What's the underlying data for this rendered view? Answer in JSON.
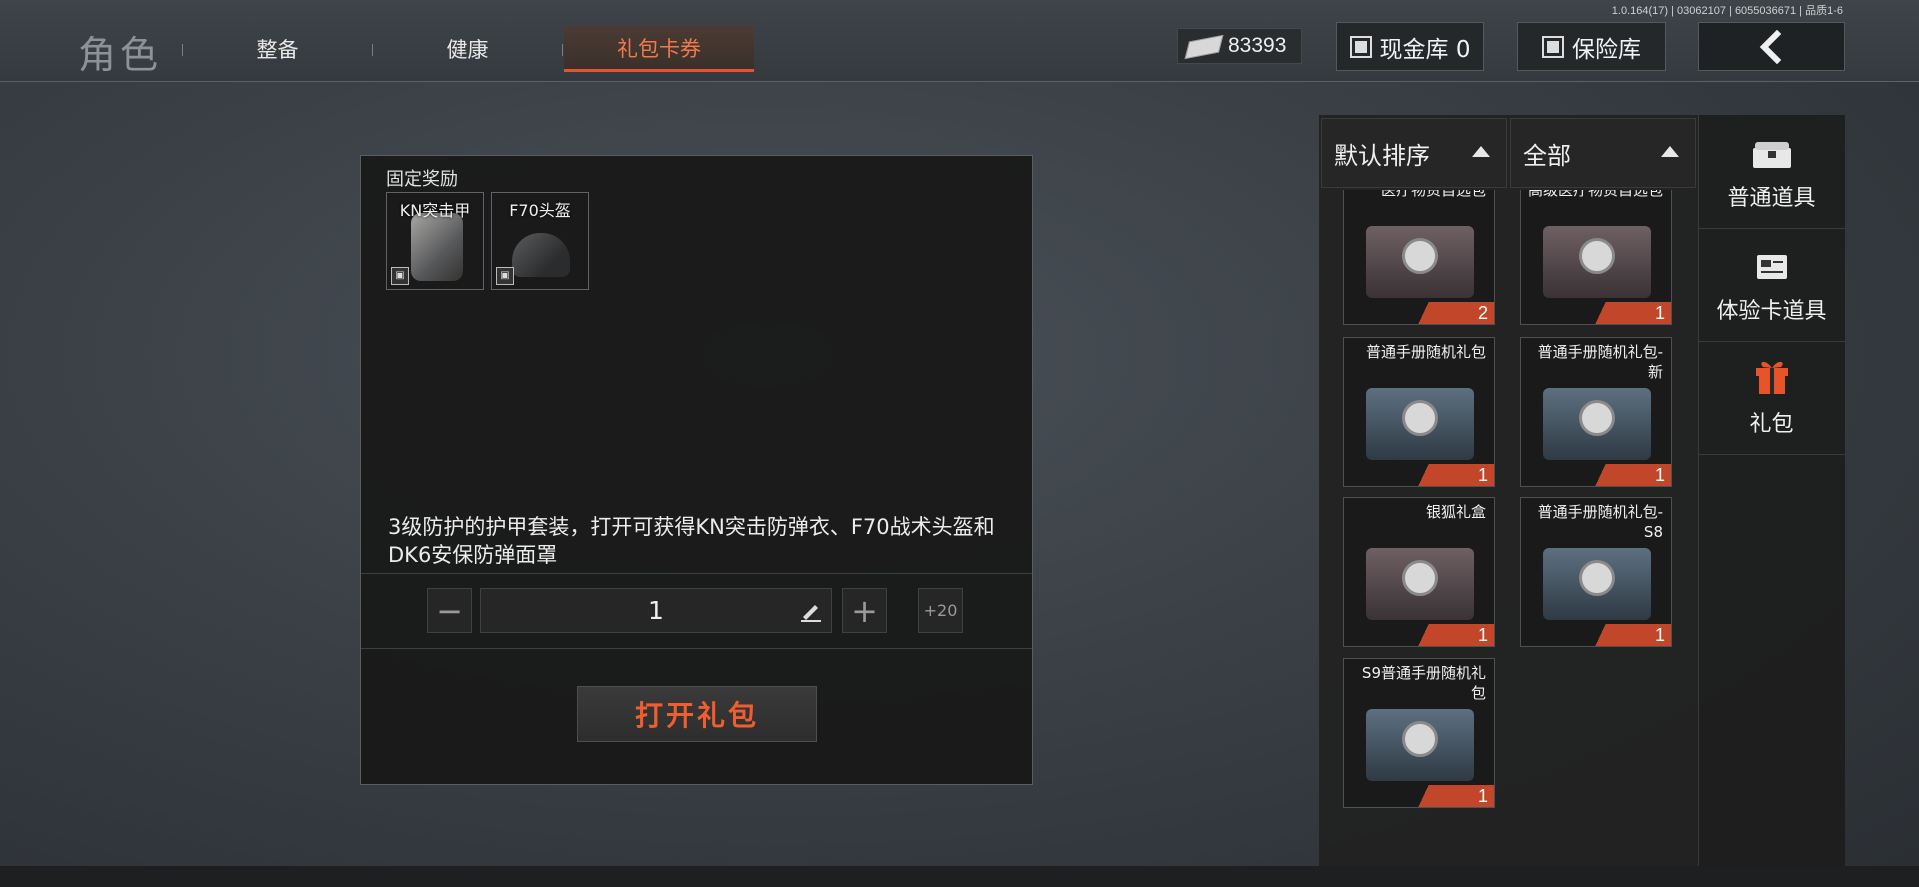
{
  "version_text": "1.0.164(17) | 03062107 | 6055036671 | 品质1-6",
  "header": {
    "title": "角色",
    "tabs": [
      {
        "label": "整备",
        "active": false
      },
      {
        "label": "健康",
        "active": false
      },
      {
        "label": "礼包卡券",
        "active": true
      }
    ],
    "currency_amount": "83393",
    "cash_vault_label": "现金库 0",
    "safe_label": "保险库",
    "back_icon": "chevron-left-icon"
  },
  "detail": {
    "fixed_rewards_label": "固定奖励",
    "rewards": [
      {
        "name": "KN突击甲",
        "icon": "armor-vest-icon"
      },
      {
        "name": "F70头盔",
        "icon": "helmet-icon"
      }
    ],
    "description": "3级防护的护甲套装，打开可获得KN突击防弹衣、F70战术头盔和DK6安保防弹面罩",
    "quantity": "1",
    "minus_label": "−",
    "plus_label": "+",
    "plus20_label": "+20",
    "open_button_label": "打开礼包"
  },
  "sort": {
    "order_label": "默认排序",
    "filter_label": "全部"
  },
  "items": [
    {
      "name": "医疗物资自选包",
      "count": "2",
      "color": "red"
    },
    {
      "name": "高级医疗物资自选包",
      "count": "1",
      "color": "red"
    },
    {
      "name": "普通手册随机礼包",
      "count": "1",
      "color": "blue"
    },
    {
      "name": "普通手册随机礼包-新",
      "count": "1",
      "color": "blue"
    },
    {
      "name": "银狐礼盒",
      "count": "1",
      "color": "red"
    },
    {
      "name": "普通手册随机礼包-S8",
      "count": "1",
      "color": "blue"
    },
    {
      "name": "S9普通手册随机礼包",
      "count": "1",
      "color": "blue"
    }
  ],
  "categories": [
    {
      "label": "普通道具",
      "icon": "chest-icon"
    },
    {
      "label": "体验卡道具",
      "icon": "card-icon"
    },
    {
      "label": "礼包",
      "icon": "gift-icon",
      "active": true
    }
  ],
  "accent_color": "#e7542a"
}
